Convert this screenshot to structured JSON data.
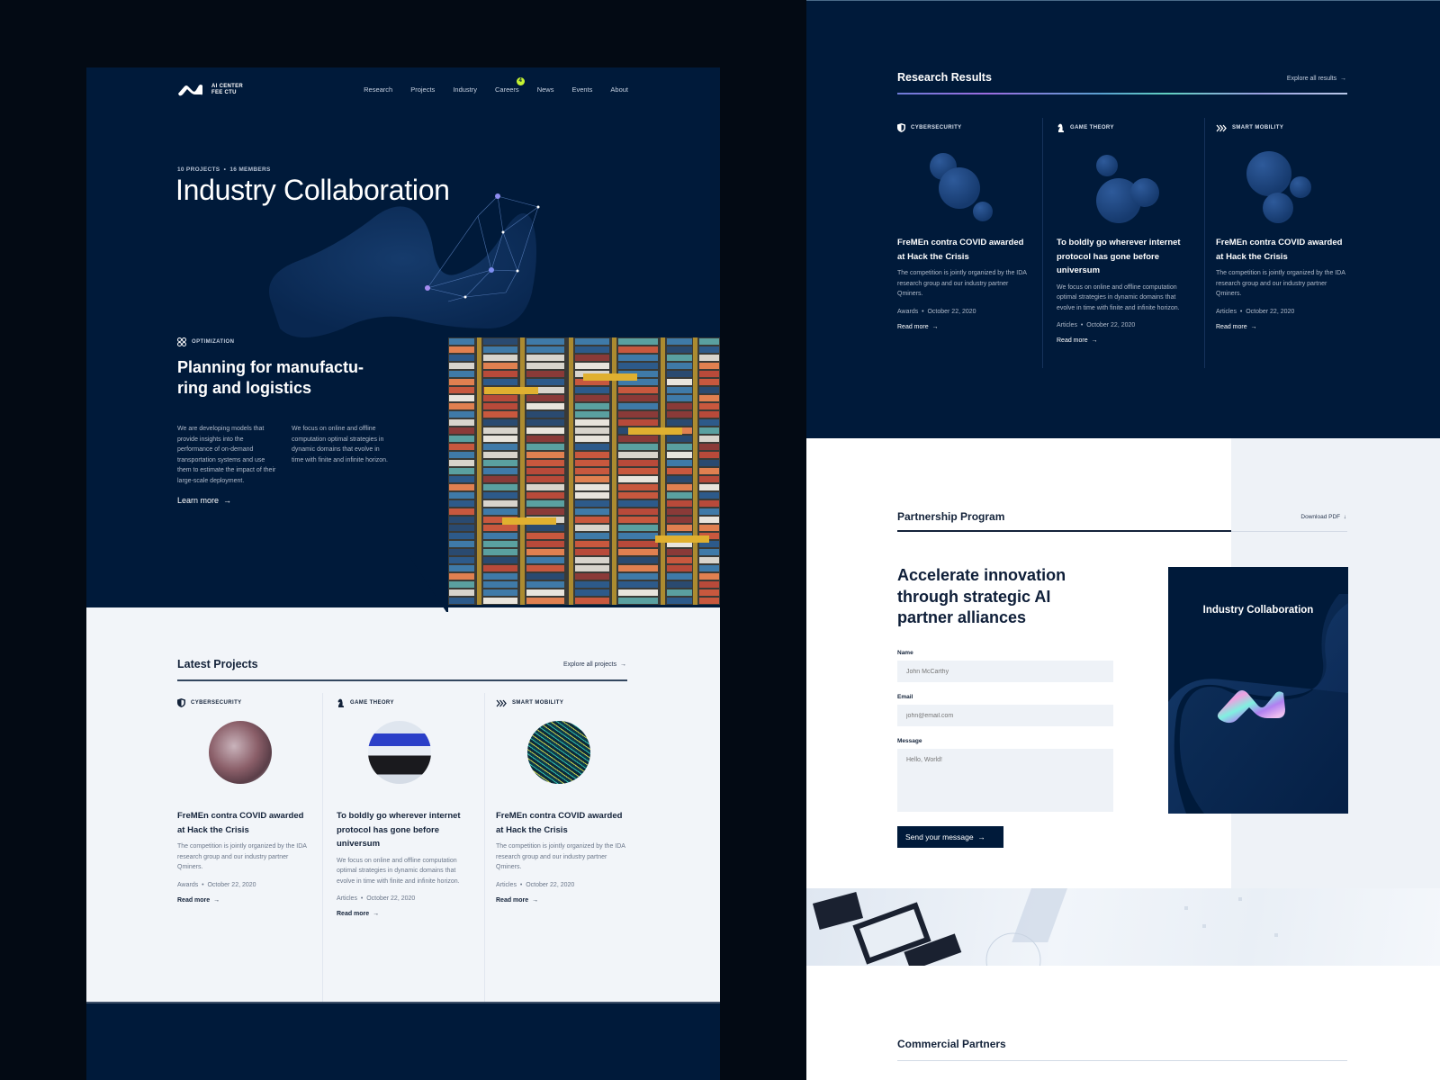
{
  "brand": {
    "logo_line1": "AI CENTER",
    "logo_line2": "FEE CTU"
  },
  "nav": {
    "items": [
      "Research",
      "Projects",
      "Industry",
      "Careers",
      "News",
      "Events",
      "About"
    ],
    "careers_badge": "4"
  },
  "hero": {
    "projects": "10 PROJECTS",
    "separator": "•",
    "members": "16 MEMBERS",
    "title": "Industry Collaboration"
  },
  "optimization": {
    "tag": "OPTIMIZATION",
    "title": "Planning for manufactu-ring and logistics",
    "paragraph_1": "We are developing models that provide insights into the performance of on-demand transportation systems and use them to estimate the impact of their large-scale deployment.",
    "paragraph_2": "We focus on online and offline computation optimal strategies in dynamic domains that evolve in time with finite and infinite horizon.",
    "learn_more": "Learn more",
    "arrow": "→",
    "image_alt": "Aerial view of container port"
  },
  "latest_projects": {
    "title": "Latest Projects",
    "explore": "Explore all projects",
    "arrow": "→",
    "cards": [
      {
        "tag": "CYBERSECURITY",
        "icon": "shield-icon",
        "title": "FreMEn contra COVID awarded at Hack the Crisis",
        "body": "The competition is jointly organized by the IDA research group and our industry partner Qminers.",
        "category": "Awards",
        "date": "October 22, 2020",
        "more": "Read more"
      },
      {
        "tag": "GAME THEORY",
        "icon": "chess-knight-icon",
        "title": "To boldly go wherever internet protocol has gone before universum",
        "body": "We focus on online and offline computation optimal strategies in dynamic domains that evolve in time with finite and infinite horizon.",
        "category": "Articles",
        "date": "October 22, 2020",
        "more": "Read more"
      },
      {
        "tag": "SMART MOBILITY",
        "icon": "chevrons-right-icon",
        "title": "FreMEn contra COVID awarded at Hack the Crisis",
        "body": "The competition is jointly organized by the IDA research group and our industry partner Qminers.",
        "category": "Articles",
        "date": "October 22, 2020",
        "more": "Read more"
      }
    ]
  },
  "research_results": {
    "title": "Research Results",
    "explore": "Explore all results",
    "arrow": "→",
    "cards": [
      {
        "tag": "CYBERSECURITY",
        "icon": "shield-icon",
        "title": "FreMEn contra COVID awarded at Hack the Crisis",
        "body": "The competition is jointly organized by the IDA research group and our industry partner Qminers.",
        "category": "Awards",
        "date": "October 22, 2020",
        "more": "Read more"
      },
      {
        "tag": "GAME THEORY",
        "icon": "chess-knight-icon",
        "title": "To boldly go wherever internet protocol has gone before universum",
        "body": "We focus on online and offline computation optimal strategies in dynamic domains that evolve in time with finite and infinite horizon.",
        "category": "Articles",
        "date": "October 22, 2020",
        "more": "Read more"
      },
      {
        "tag": "SMART MOBILITY",
        "icon": "chevrons-right-icon",
        "title": "FreMEn contra COVID awarded at Hack the Crisis",
        "body": "The competition is jointly organized by the IDA research group and our industry partner Qminers.",
        "category": "Articles",
        "date": "October 22, 2020",
        "more": "Read more"
      }
    ]
  },
  "partnership": {
    "title": "Partnership Program",
    "download": "Download PDF",
    "download_arrow": "↓",
    "headline": "Accelerate innovation through strategic AI partner alliances",
    "form": {
      "name_label": "Name",
      "name_placeholder": "John McCarthy",
      "email_label": "Email",
      "email_placeholder": "john@email.com",
      "message_label": "Message",
      "message_placeholder": "Hello, World!",
      "submit": "Send your message",
      "submit_arrow": "→"
    },
    "promo_title": "Industry Collaboration"
  },
  "commercial_partners": {
    "title": "Commercial Partners"
  },
  "colors": {
    "navy": "#001a3a",
    "light_bg": "#f2f5f9",
    "accent_badge": "#c6f432",
    "text_dark": "#14233a"
  }
}
